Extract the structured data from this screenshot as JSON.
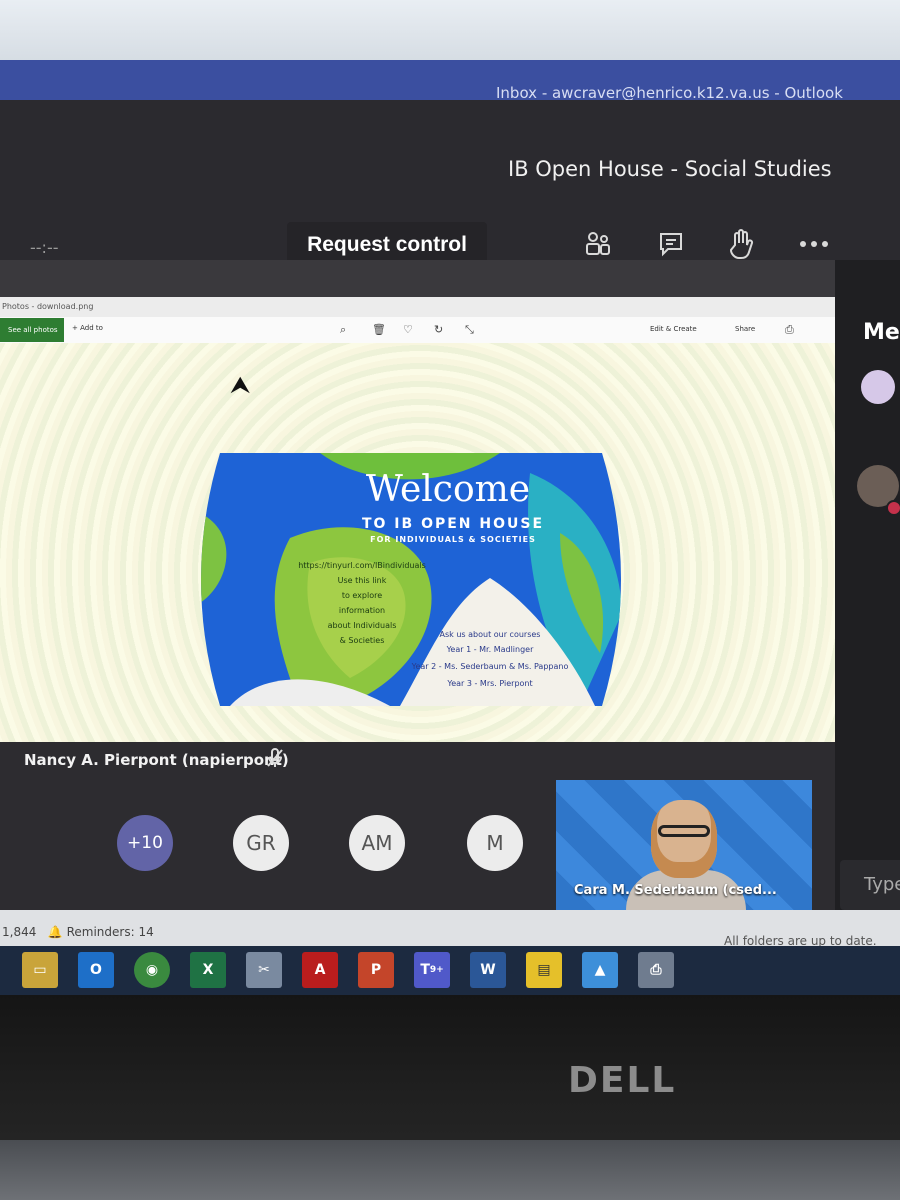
{
  "outlook": {
    "window_title": "Inbox - awcraver@henrico.k12.va.us - Outlook"
  },
  "meeting": {
    "title": "IB Open House - Social Studies",
    "timer": "--:--",
    "request_control_label": "Request control"
  },
  "header_icons": [
    "participants-icon",
    "chat-icon",
    "raise-hand-icon",
    "more-options-icon"
  ],
  "photos_app": {
    "window_title": "Photos - download.png",
    "see_all_label": "See all photos",
    "add_to_label": "+ Add to",
    "edit_create_label": "Edit & Create",
    "share_label": "Share"
  },
  "slide": {
    "headline": "Welcome",
    "subheadline": "TO IB OPEN HOUSE",
    "tagline": "FOR INDIVIDUALS & SOCIETIES",
    "link_lines": [
      "https://tinyurl.com/IBindividuals",
      "Use this link",
      "to explore",
      "information",
      "about Individuals",
      "& Societies"
    ],
    "course_lines": [
      "Ask us about our courses",
      "Year 1 - Mr. Madlinger",
      "Year 2 - Ms. Sederbaum & Ms. Pappano",
      "Year 3 - Mrs. Pierpont"
    ]
  },
  "presenter": {
    "name": "Nancy A. Pierpont (napierpont)"
  },
  "participants": {
    "overflow_label": "+10",
    "avatars": [
      "GR",
      "AM",
      "M"
    ],
    "video_name": "Cara M. Sederbaum (csed..."
  },
  "side_panel": {
    "title_fragment": "Me",
    "compose_placeholder": "Type"
  },
  "status_bar": {
    "left_text": "1,844",
    "reminders": "Reminders: 14",
    "right_text": "All folders are up to date."
  },
  "taskbar": {
    "apps": [
      "File Explorer",
      "Outlook",
      "Chrome",
      "Excel",
      "Snipping",
      "Acrobat",
      "PowerPoint",
      "Teams",
      "Word",
      "Sticky Notes",
      "Photos",
      "Printer"
    ],
    "teams_badge": "9+"
  },
  "brand": {
    "bezel_logo": "DELL",
    "teams_accent": "#7b83eb",
    "outlook_blue": "#3b4fa0"
  }
}
